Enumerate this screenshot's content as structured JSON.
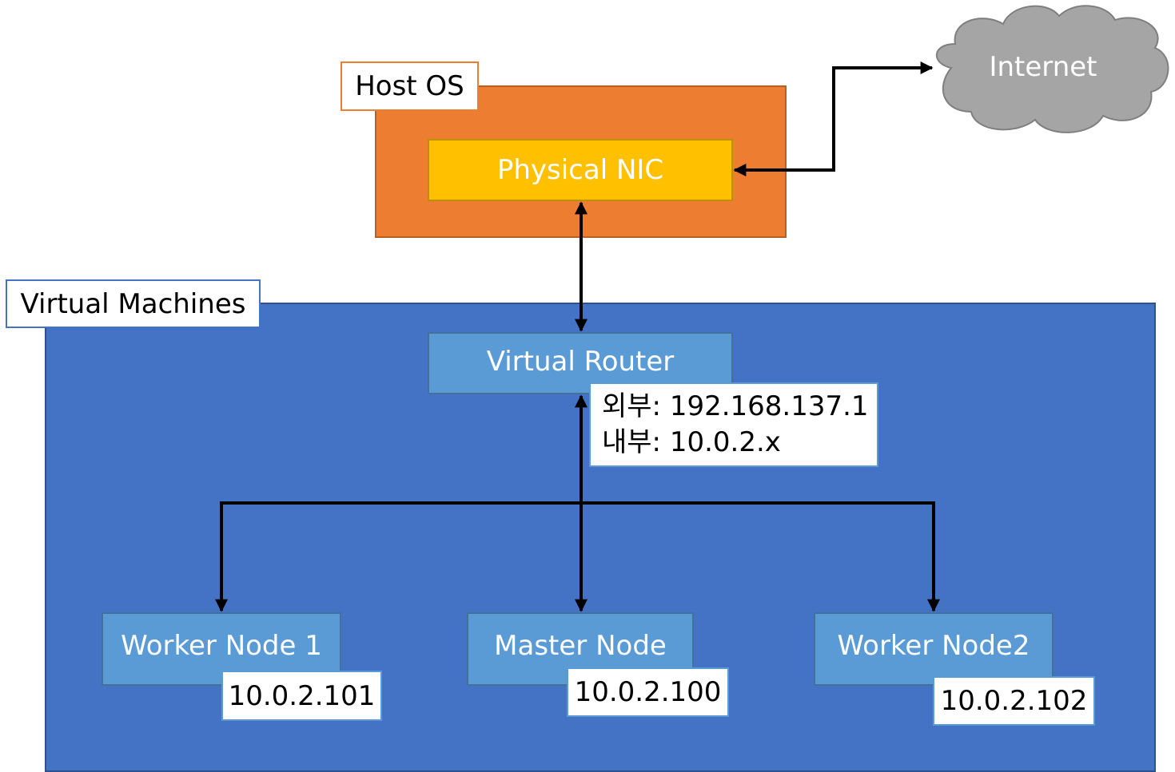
{
  "diagram": {
    "host_os": {
      "label": "Host OS",
      "color": "#ED7D31"
    },
    "physical_nic": {
      "label": "Physical NIC",
      "color": "#FFC000"
    },
    "internet": {
      "label": "Internet",
      "color": "#A5A5A5"
    },
    "virtual_machines": {
      "label": "Virtual Machines",
      "color": "#4472C4"
    },
    "virtual_router": {
      "label": "Virtual Router",
      "external": "외부: 192.168.137.1",
      "internal": "내부: 10.0.2.x"
    },
    "nodes": [
      {
        "label": "Worker Node 1",
        "ip": "10.0.2.101"
      },
      {
        "label": "Master Node",
        "ip": "10.0.2.100"
      },
      {
        "label": "Worker Node2",
        "ip": "10.0.2.102"
      }
    ],
    "connections": [
      {
        "from": "Physical NIC",
        "to": "Internet",
        "type": "bidirectional"
      },
      {
        "from": "Physical NIC",
        "to": "Virtual Router",
        "type": "bidirectional"
      },
      {
        "from": "Virtual Router",
        "to": "Worker Node 1",
        "type": "bidirectional"
      },
      {
        "from": "Virtual Router",
        "to": "Master Node",
        "type": "bidirectional"
      },
      {
        "from": "Virtual Router",
        "to": "Worker Node2",
        "type": "bidirectional"
      }
    ]
  }
}
